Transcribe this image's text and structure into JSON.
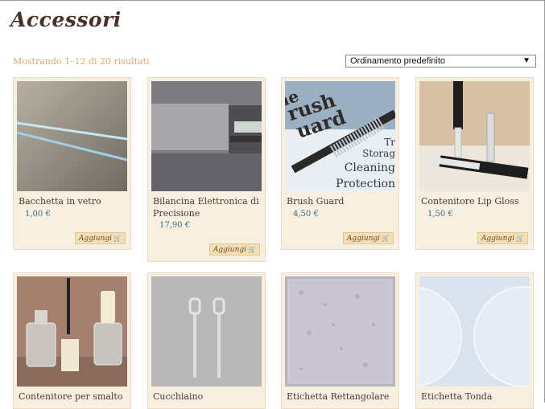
{
  "page": {
    "title": "Accessori",
    "result_count": "Mostrando 1–12 di 20 risultati"
  },
  "sort": {
    "selected": "Ordinamento predefinito",
    "icon": "dropdown-arrow-icon"
  },
  "add_button_label": "Aggiungi",
  "colors": {
    "title": "#4a2f2a",
    "result_count": "#d8a86a",
    "price": "#3a6b8a",
    "card_bg": "#f7efe0",
    "button_bg": "#f2dfb5"
  },
  "products": [
    {
      "name": "Bacchetta in vetro",
      "price": "1,00 €"
    },
    {
      "name": "Bilancina Elettronica di Precisione",
      "price": "17,90 €"
    },
    {
      "name": "Brush Guard",
      "price": "4,50 €"
    },
    {
      "name": "Contenitore Lip Gloss",
      "price": "1,50 €"
    },
    {
      "name": "Contenitore per smalto",
      "price": ""
    },
    {
      "name": "Cucchiaino",
      "price": ""
    },
    {
      "name": "Etichetta Rettangolare",
      "price": ""
    },
    {
      "name": "Etichetta Tonda",
      "price": ""
    }
  ],
  "brush_guard_image_text": [
    "he",
    "rush",
    "uard",
    "Tr",
    "Storag",
    "Cleaning",
    "Protection"
  ]
}
